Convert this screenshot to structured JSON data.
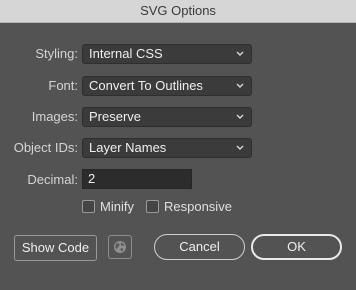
{
  "window": {
    "title": "SVG Options"
  },
  "fields": {
    "styling": {
      "label": "Styling:",
      "value": "Internal CSS"
    },
    "font": {
      "label": "Font:",
      "value": "Convert To Outlines"
    },
    "images": {
      "label": "Images:",
      "value": "Preserve"
    },
    "object_ids": {
      "label": "Object IDs:",
      "value": "Layer Names"
    },
    "decimal": {
      "label": "Decimal:",
      "value": "2"
    }
  },
  "checkboxes": {
    "minify": {
      "label": "Minify",
      "checked": false
    },
    "responsive": {
      "label": "Responsive",
      "checked": false
    }
  },
  "buttons": {
    "show_code": "Show Code",
    "cancel": "Cancel",
    "ok": "OK",
    "globe_icon": "globe-icon"
  }
}
